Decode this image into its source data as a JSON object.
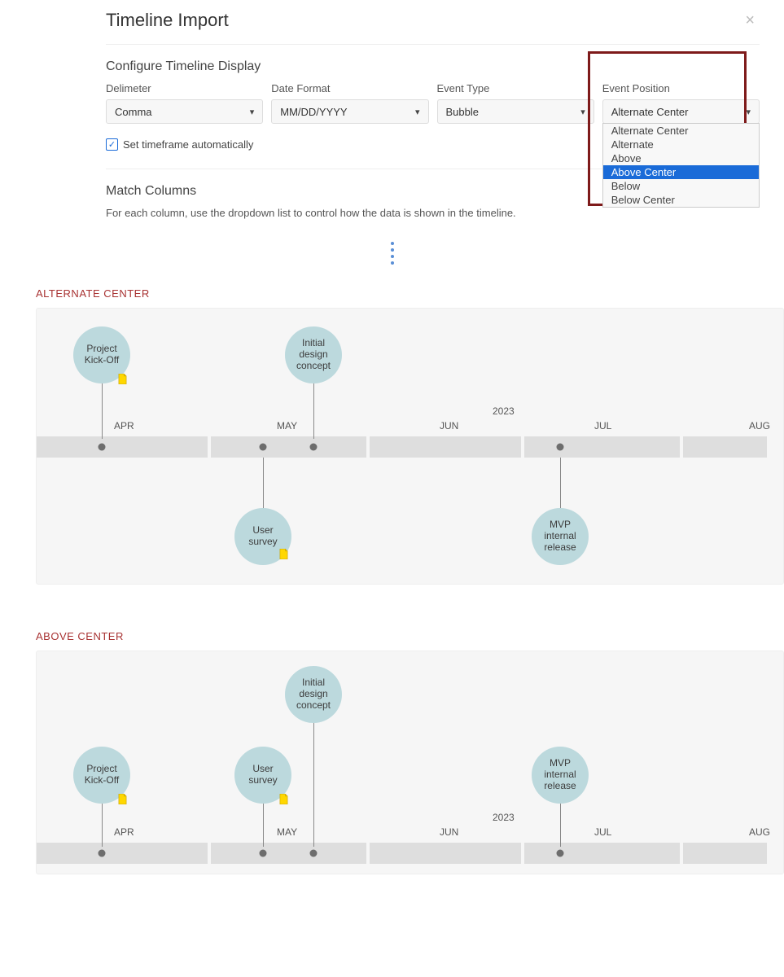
{
  "dialog": {
    "title": "Timeline Import",
    "section_configure": "Configure Timeline Display",
    "labels": {
      "delimiter": "Delimeter",
      "date_format": "Date Format",
      "event_type": "Event Type",
      "event_position": "Event Position"
    },
    "values": {
      "delimiter": "Comma",
      "date_format": "MM/DD/YYYY",
      "event_type": "Bubble",
      "event_position": "Alternate Center"
    },
    "checkbox": "Set timeframe automatically",
    "section_match": "Match Columns",
    "match_desc": "For each column, use the dropdown list to control how the data is shown in the timeline.",
    "position_options": [
      "Alternate Center",
      "Alternate",
      "Above",
      "Above Center",
      "Below",
      "Below Center"
    ],
    "position_highlighted": "Above Center"
  },
  "sections": {
    "alternate_center": "ALTERNATE CENTER",
    "above_center": "ABOVE CENTER"
  },
  "timeline": {
    "year": "2023",
    "months": [
      "APR",
      "MAY",
      "JUN",
      "JUL",
      "AUG"
    ],
    "events": {
      "kickoff": "Project\nKick-Off",
      "survey": "User\nsurvey",
      "design": "Initial\ndesign\nconcept",
      "mvp": "MVP\ninternal\nrelease"
    }
  }
}
